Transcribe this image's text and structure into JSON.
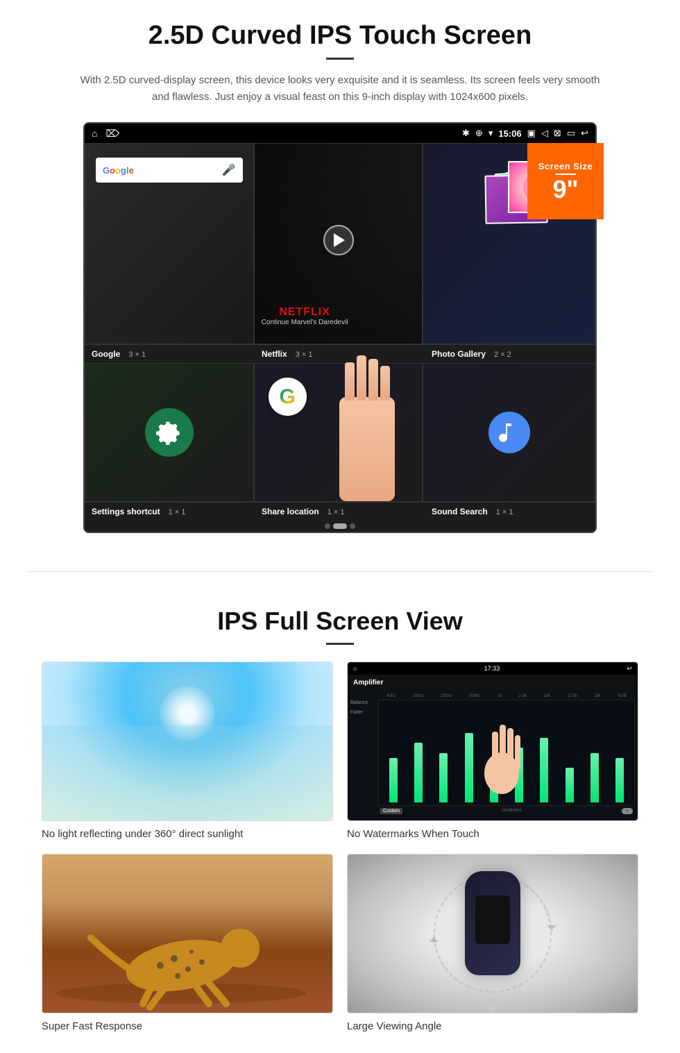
{
  "section1": {
    "title": "2.5D Curved IPS Touch Screen",
    "description": "With 2.5D curved-display screen, this device looks very exquisite and it is seamless. Its screen feels very smooth and flawless. Just enjoy a visual feast on this 9-inch display with 1024x600 pixels.",
    "badge": {
      "title": "Screen Size",
      "size": "9\""
    },
    "statusBar": {
      "time": "15:06"
    },
    "apps": [
      {
        "name": "Google",
        "size": "3 × 1"
      },
      {
        "name": "Netflix",
        "size": "3 × 1"
      },
      {
        "name": "Photo Gallery",
        "size": "2 × 2"
      },
      {
        "name": "Settings shortcut",
        "size": "1 × 1"
      },
      {
        "name": "Share location",
        "size": "1 × 1"
      },
      {
        "name": "Sound Search",
        "size": "1 × 1"
      }
    ],
    "netflix": {
      "brand": "NETFLIX",
      "subtitle": "Continue Marvel's Daredevil"
    }
  },
  "section2": {
    "title": "IPS Full Screen View",
    "features": [
      {
        "caption": "No light reflecting under 360° direct sunlight"
      },
      {
        "caption": "No Watermarks When Touch"
      },
      {
        "caption": "Super Fast Response"
      },
      {
        "caption": "Large Viewing Angle"
      }
    ]
  }
}
